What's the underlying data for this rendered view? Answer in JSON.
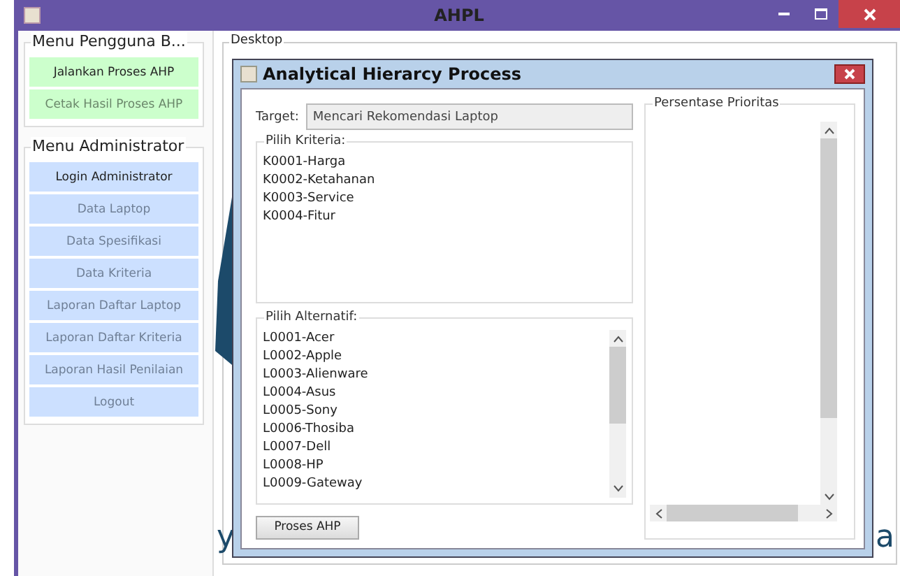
{
  "window": {
    "title": "AHPL"
  },
  "user_menu": {
    "title": "Menu Pengguna B...",
    "buttons": [
      {
        "label": "Jalankan Proses AHP",
        "disabled": false
      },
      {
        "label": "Cetak Hasil Proses AHP",
        "disabled": true
      }
    ]
  },
  "admin_menu": {
    "title": "Menu Administrator",
    "buttons": [
      {
        "label": "Login Administrator",
        "disabled": false
      },
      {
        "label": "Data Laptop",
        "disabled": true
      },
      {
        "label": "Data Spesifikasi",
        "disabled": true
      },
      {
        "label": "Data Kriteria",
        "disabled": true
      },
      {
        "label": "Laporan Daftar Laptop",
        "disabled": true
      },
      {
        "label": "Laporan Daftar Kriteria",
        "disabled": true
      },
      {
        "label": "Laporan Hasil Penilaian",
        "disabled": true
      },
      {
        "label": "Logout",
        "disabled": true
      }
    ]
  },
  "desktop": {
    "title": "Desktop",
    "background_text": [
      "y",
      "a"
    ]
  },
  "dialog": {
    "title": "Analytical Hierarcy Process",
    "target": {
      "label": "Target:",
      "value": "Mencari Rekomendasi Laptop"
    },
    "criteria": {
      "title": "Pilih Kriteria:",
      "items": [
        "K0001-Harga",
        "K0002-Ketahanan",
        "K0003-Service",
        "K0004-Fitur"
      ]
    },
    "alternatives": {
      "title": "Pilih Alternatif:",
      "items": [
        "L0001-Acer",
        "L0002-Apple",
        "L0003-Alienware",
        "L0004-Asus",
        "L0005-Sony",
        "L0006-Thosiba",
        "L0007-Dell",
        "L0008-HP",
        "L0009-Gateway"
      ]
    },
    "button": "Proses AHP",
    "priority": {
      "title": "Persentase Prioritas"
    }
  }
}
